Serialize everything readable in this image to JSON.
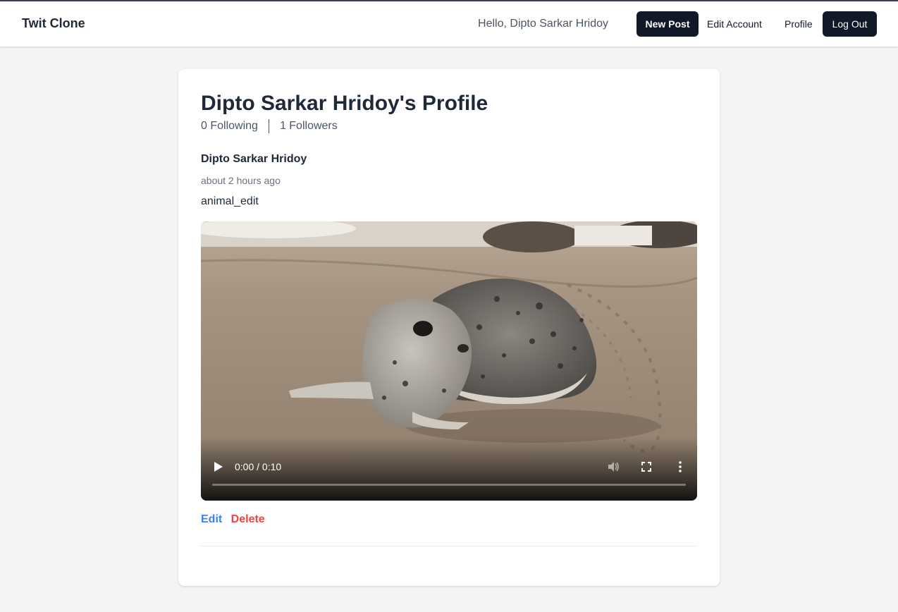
{
  "navbar": {
    "brand": "Twit Clone",
    "greeting": "Hello, Dipto Sarkar Hridoy",
    "new_post": "New Post",
    "edit_account": "Edit Account",
    "profile": "Profile",
    "log_out": "Log Out"
  },
  "profile": {
    "title": "Dipto Sarkar Hridoy's Profile",
    "following": "0 Following",
    "followers": "1 Followers"
  },
  "post": {
    "author": "Dipto Sarkar Hridoy",
    "time": "about 2 hours ago",
    "body": "animal_edit",
    "video": {
      "time_display": "0:00 / 0:10",
      "progress": 0
    },
    "edit_label": "Edit",
    "delete_label": "Delete"
  },
  "icons": {
    "play": "play-icon",
    "volume": "volume-icon",
    "fullscreen": "fullscreen-icon",
    "more": "more-vertical-icon"
  },
  "colors": {
    "dark_button": "#111827",
    "edit_link": "#3b82f6",
    "delete_link": "#ef4444",
    "page_bg": "#f3f4f6"
  }
}
